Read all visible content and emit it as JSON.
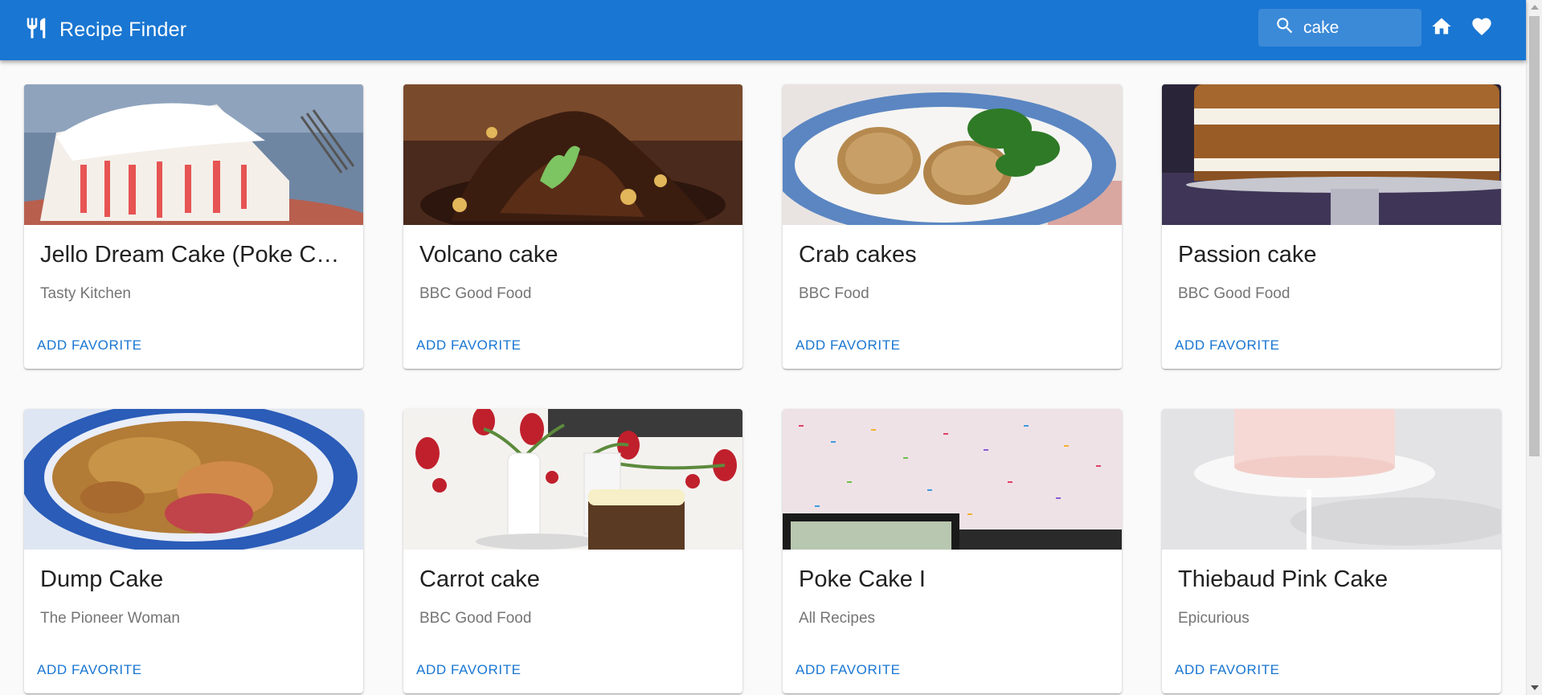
{
  "app": {
    "title": "Recipe Finder",
    "brand_icon": "restaurant-icon",
    "accent_color": "#1976d2"
  },
  "search": {
    "value": "cake",
    "icon": "search-icon"
  },
  "nav": {
    "home_icon": "home-icon",
    "favorites_icon": "heart-icon"
  },
  "recipes": [
    {
      "title": "Jello Dream Cake (Poke Cake)",
      "source": "Tasty Kitchen",
      "action": "ADD FAVORITE"
    },
    {
      "title": "Volcano cake",
      "source": "BBC Good Food",
      "action": "ADD FAVORITE"
    },
    {
      "title": "Crab cakes",
      "source": "BBC Food",
      "action": "ADD FAVORITE"
    },
    {
      "title": "Passion cake",
      "source": "BBC Good Food",
      "action": "ADD FAVORITE"
    },
    {
      "title": "Dump Cake",
      "source": "The Pioneer Woman",
      "action": "ADD FAVORITE"
    },
    {
      "title": "Carrot cake",
      "source": "BBC Good Food",
      "action": "ADD FAVORITE"
    },
    {
      "title": "Poke Cake I",
      "source": "All Recipes",
      "action": "ADD FAVORITE"
    },
    {
      "title": "Thiebaud Pink Cake",
      "source": "Epicurious",
      "action": "ADD FAVORITE"
    }
  ]
}
